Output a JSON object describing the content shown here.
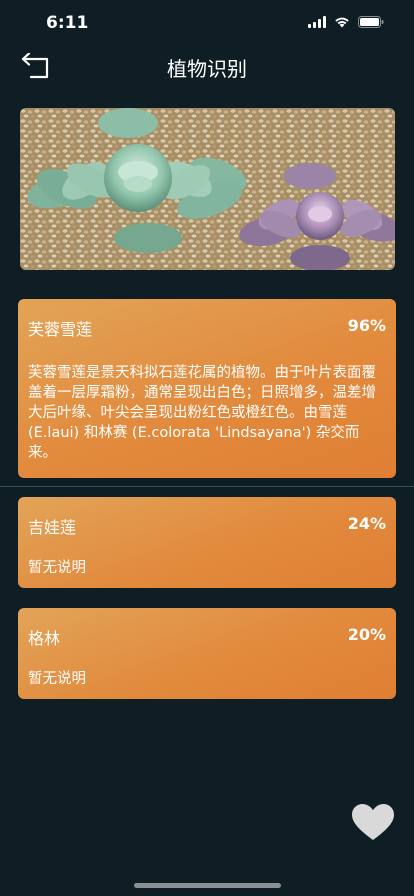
{
  "status_bar": {
    "time": "6:11"
  },
  "nav": {
    "title": "植物识别"
  },
  "results": [
    {
      "name": "芙蓉雪莲",
      "confidence": "96%",
      "description": "芙蓉雪莲是景天科拟石莲花属的植物。由于叶片表面覆盖着一层厚霜粉，通常呈现出白色；日照增多，温差增大后叶缘、叶尖会呈现出粉红色或橙红色。由雪莲 (E.laui) 和林赛 (E.colorata 'Lindsayana') 杂交而来。"
    },
    {
      "name": "吉娃莲",
      "confidence": "24%",
      "description": "暂无说明"
    },
    {
      "name": "格林",
      "confidence": "20%",
      "description": "暂无说明"
    }
  ],
  "icons": {
    "back": "back-arrow-icon",
    "favorite": "heart-icon",
    "signal": "signal-icon",
    "wifi": "wifi-icon",
    "battery": "battery-icon"
  },
  "colors": {
    "background": "#0f1d24",
    "card_start": "#e2a458",
    "card_end": "#df7f33",
    "heart": "#d9d9d9"
  }
}
